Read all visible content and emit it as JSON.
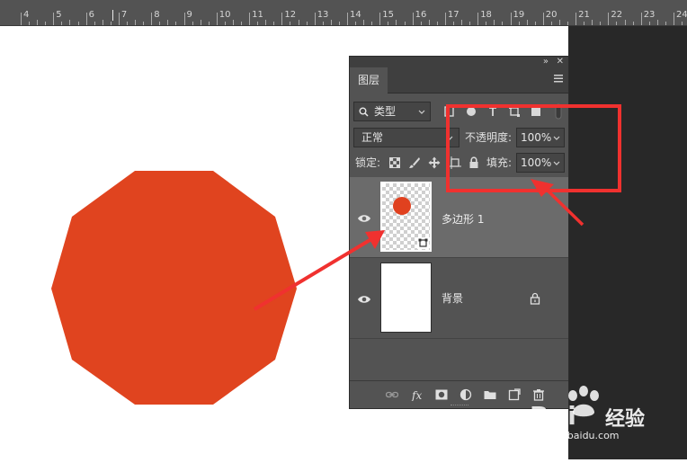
{
  "ruler": {
    "labels": [
      "4",
      "5",
      "6",
      "7",
      "8",
      "9",
      "10",
      "11",
      "12",
      "13",
      "14",
      "15",
      "16",
      "17",
      "18",
      "19",
      "20",
      "21",
      "22",
      "23",
      "24"
    ]
  },
  "layers_panel": {
    "tab_label": "图层",
    "filter": {
      "label": "类型"
    },
    "blend_mode": "正常",
    "opacity": {
      "label": "不透明度:",
      "value": "100%"
    },
    "lock_label": "锁定:",
    "fill": {
      "label": "填充:",
      "value": "100%"
    },
    "layers": [
      {
        "name": "多边形 1",
        "selected": true,
        "thumb_dot_color": "#e0411f"
      },
      {
        "name": "背景",
        "selected": false,
        "locked": true
      }
    ]
  },
  "canvas": {
    "shape_color": "#e0441f",
    "annotation_color": "#f0312f"
  },
  "watermark": {
    "brand": "Bai",
    "brand_cn": "经验",
    "url": "jingyan.baidu.com"
  }
}
